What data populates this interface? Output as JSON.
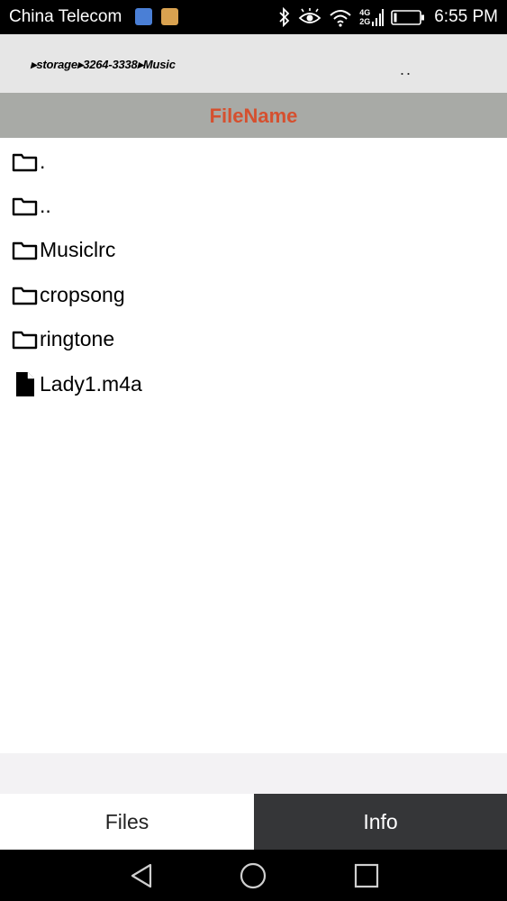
{
  "status_bar": {
    "carrier": "China Telecom",
    "network_top": "4G",
    "network_bottom": "2G",
    "time": "6:55 PM"
  },
  "path_bar": {
    "breadcrumb": "▸storage▸3264-3338▸Music",
    "up_label": ".."
  },
  "header": {
    "title": "FileName",
    "title_color": "#d5502f"
  },
  "files": [
    {
      "name": ".",
      "type": "folder",
      "icon": "folder-icon"
    },
    {
      "name": "..",
      "type": "folder",
      "icon": "folder-icon"
    },
    {
      "name": "Musiclrc",
      "type": "folder",
      "icon": "folder-icon"
    },
    {
      "name": "cropsong",
      "type": "folder",
      "icon": "folder-icon"
    },
    {
      "name": "ringtone",
      "type": "folder",
      "icon": "folder-icon"
    },
    {
      "name": "Lady1.m4a",
      "type": "file",
      "icon": "file-icon"
    }
  ],
  "tabs": {
    "files": "Files",
    "info": "Info"
  },
  "colors": {
    "header_bg": "#a8aaa6",
    "path_bg": "#e6e6e6",
    "active_tab_bg": "#ffffff",
    "inactive_tab_bg": "#353638"
  }
}
